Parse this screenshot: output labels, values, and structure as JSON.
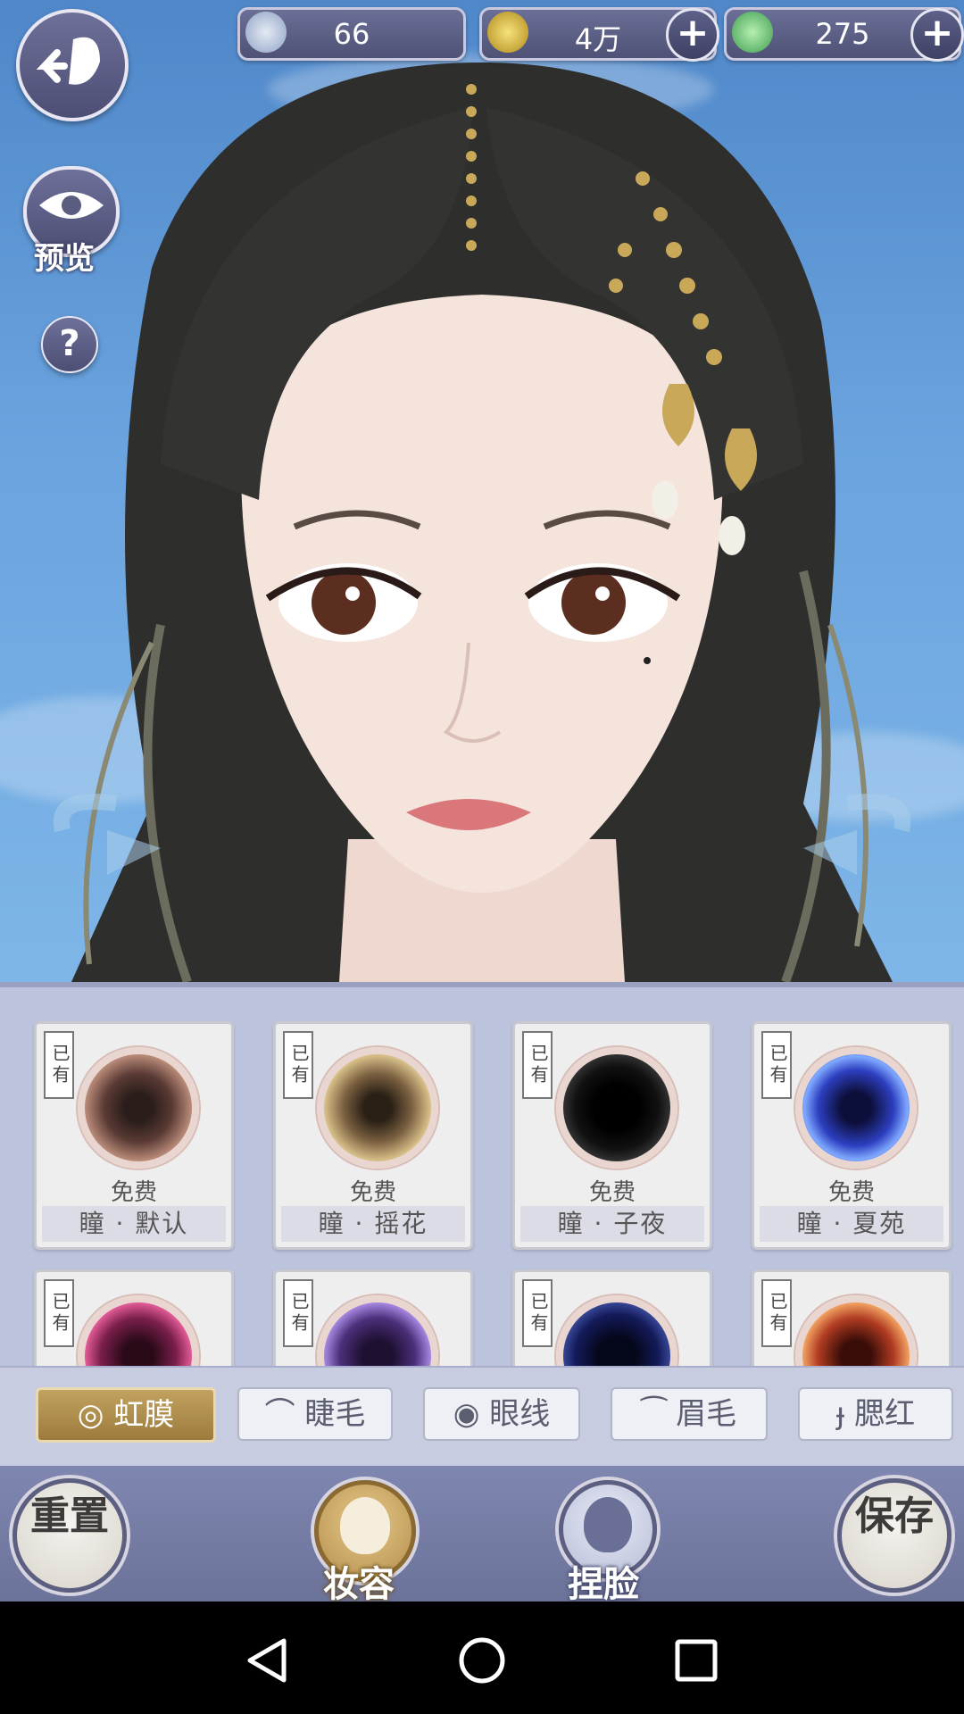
{
  "currencies": [
    {
      "icon": "silver-leaf-coin-icon",
      "value": "66"
    },
    {
      "icon": "gold-coin-icon",
      "value": "4万"
    },
    {
      "icon": "jade-coin-icon",
      "value": "275"
    }
  ],
  "side": {
    "preview_label": "预览",
    "help_label": "?"
  },
  "eye_items": [
    {
      "status": "已有",
      "price": "免费",
      "name": "瞳 · 默认",
      "color": "#5a3a34"
    },
    {
      "status": "已有",
      "price": "免费",
      "name": "瞳 · 摇花",
      "color": "#7a6040"
    },
    {
      "status": "已有",
      "price": "免费",
      "name": "瞳 · 子夜",
      "color": "#111111"
    },
    {
      "status": "已有",
      "price": "免费",
      "name": "瞳 · 夏苑",
      "color": "#2d3fc0"
    },
    {
      "status": "已有",
      "color": "#7a1f4a"
    },
    {
      "status": "已有",
      "color": "#4b2f7a"
    },
    {
      "status": "已有",
      "color": "#141b5a"
    },
    {
      "status": "已有",
      "color": "#b03b22"
    }
  ],
  "tabs": [
    {
      "label": "◎ 虹膜",
      "active": true
    },
    {
      "label": "睫毛",
      "icon": "eyelash-icon"
    },
    {
      "label": "眼线",
      "icon": "eye-icon"
    },
    {
      "label": "眉毛",
      "icon": "eyebrow-icon"
    },
    {
      "label": "腮红",
      "icon": "blush-icon"
    }
  ],
  "bottom": {
    "reset_label": "重置",
    "makeup_label": "妆容",
    "face_label": "捏脸",
    "save_label": "保存"
  }
}
